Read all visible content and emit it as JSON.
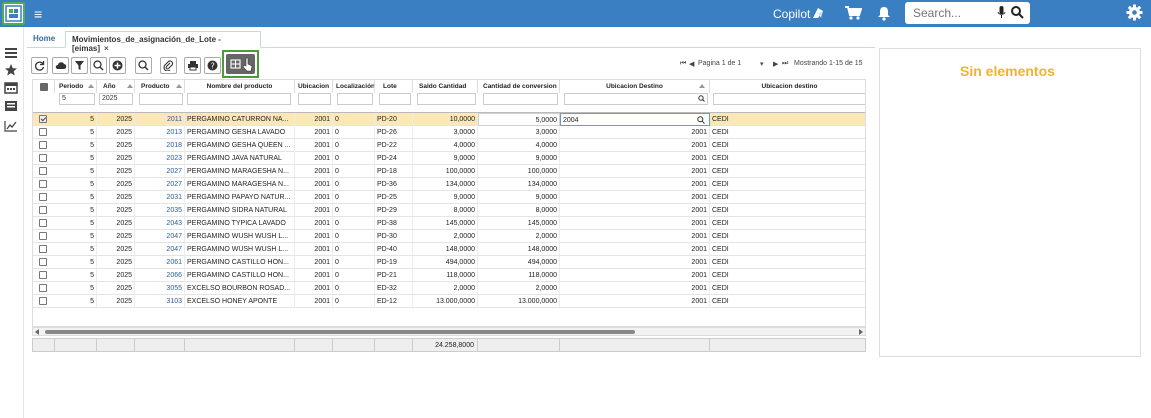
{
  "header": {
    "copilot_label": "Copilot",
    "search_placeholder": "Search..."
  },
  "tabs": [
    {
      "label": "Home"
    },
    {
      "label": "Movimientos_de_asignación_de_Lote -[eimas]",
      "close": "×"
    }
  ],
  "pager": {
    "first": "⏮",
    "prev": "◀",
    "page_text": "Pagina 1 de 1",
    "dropdown": "▾",
    "next": "▶",
    "last": "⏭",
    "showing_text": "Mostrando 1-15 de 15"
  },
  "grid": {
    "columns": [
      "Periodo",
      "Año",
      "Producto",
      "Nombre del producto",
      "Ubicacion",
      "Localización",
      "Lote",
      "Saldo Cantidad",
      "Cantidad de conversion",
      "Ubicacion Destino",
      "Ubicacion destino"
    ],
    "filters": {
      "periodo": "5",
      "anio": "2025"
    },
    "rows": [
      {
        "periodo": "5",
        "anio": "2025",
        "producto": "2011",
        "nombre": "PERGAMINO CATURRON NA...",
        "ubicacion": "2001",
        "loc": "0",
        "lote": "PD-20",
        "saldo": "10,0000",
        "conv": "5,0000",
        "destino": "2004",
        "destino2": "CEDI"
      },
      {
        "periodo": "5",
        "anio": "2025",
        "producto": "2013",
        "nombre": "PERGAMINO GESHA LAVADO",
        "ubicacion": "2001",
        "loc": "0",
        "lote": "PD-26",
        "saldo": "3,0000",
        "conv": "3,0000",
        "destino": "2001",
        "destino2": "CEDI"
      },
      {
        "periodo": "5",
        "anio": "2025",
        "producto": "2018",
        "nombre": "PERGAMINO GESHA QUEEN ...",
        "ubicacion": "2001",
        "loc": "0",
        "lote": "PD-22",
        "saldo": "4,0000",
        "conv": "4,0000",
        "destino": "2001",
        "destino2": "CEDI"
      },
      {
        "periodo": "5",
        "anio": "2025",
        "producto": "2023",
        "nombre": "PERGAMINO JAVA NATURAL",
        "ubicacion": "2001",
        "loc": "0",
        "lote": "PD-24",
        "saldo": "9,0000",
        "conv": "9,0000",
        "destino": "2001",
        "destino2": "CEDI"
      },
      {
        "periodo": "5",
        "anio": "2025",
        "producto": "2027",
        "nombre": "PERGAMINO MARAGESHA N...",
        "ubicacion": "2001",
        "loc": "0",
        "lote": "PD-18",
        "saldo": "100,0000",
        "conv": "100,0000",
        "destino": "2001",
        "destino2": "CEDI"
      },
      {
        "periodo": "5",
        "anio": "2025",
        "producto": "2027",
        "nombre": "PERGAMINO MARAGESHA N...",
        "ubicacion": "2001",
        "loc": "0",
        "lote": "PD-36",
        "saldo": "134,0000",
        "conv": "134,0000",
        "destino": "2001",
        "destino2": "CEDI"
      },
      {
        "periodo": "5",
        "anio": "2025",
        "producto": "2031",
        "nombre": "PERGAMINO PAPAYO NATUR...",
        "ubicacion": "2001",
        "loc": "0",
        "lote": "PD-25",
        "saldo": "9,0000",
        "conv": "9,0000",
        "destino": "2001",
        "destino2": "CEDI"
      },
      {
        "periodo": "5",
        "anio": "2025",
        "producto": "2035",
        "nombre": "PERGAMINO SIDRA NATURAL",
        "ubicacion": "2001",
        "loc": "0",
        "lote": "PD-29",
        "saldo": "8,0000",
        "conv": "8,0000",
        "destino": "2001",
        "destino2": "CEDI"
      },
      {
        "periodo": "5",
        "anio": "2025",
        "producto": "2043",
        "nombre": "PERGAMINO TYPICA LAVADO",
        "ubicacion": "2001",
        "loc": "0",
        "lote": "PD-38",
        "saldo": "145,0000",
        "conv": "145,0000",
        "destino": "2001",
        "destino2": "CEDI"
      },
      {
        "periodo": "5",
        "anio": "2025",
        "producto": "2047",
        "nombre": "PERGAMINO WUSH WUSH L...",
        "ubicacion": "2001",
        "loc": "0",
        "lote": "PD-30",
        "saldo": "2,0000",
        "conv": "2,0000",
        "destino": "2001",
        "destino2": "CEDI"
      },
      {
        "periodo": "5",
        "anio": "2025",
        "producto": "2047",
        "nombre": "PERGAMINO WUSH WUSH L...",
        "ubicacion": "2001",
        "loc": "0",
        "lote": "PD-40",
        "saldo": "148,0000",
        "conv": "148,0000",
        "destino": "2001",
        "destino2": "CEDI"
      },
      {
        "periodo": "5",
        "anio": "2025",
        "producto": "2061",
        "nombre": "PERGAMINO CASTILLO HON...",
        "ubicacion": "2001",
        "loc": "0",
        "lote": "PD-19",
        "saldo": "494,0000",
        "conv": "494,0000",
        "destino": "2001",
        "destino2": "CEDI"
      },
      {
        "periodo": "5",
        "anio": "2025",
        "producto": "2066",
        "nombre": "PERGAMINO CASTILLO HON...",
        "ubicacion": "2001",
        "loc": "0",
        "lote": "PD-21",
        "saldo": "118,0000",
        "conv": "118,0000",
        "destino": "2001",
        "destino2": "CEDI"
      },
      {
        "periodo": "5",
        "anio": "2025",
        "producto": "3055",
        "nombre": "EXCELSO BOURBON ROSAD...",
        "ubicacion": "2001",
        "loc": "0",
        "lote": "ED-32",
        "saldo": "2,0000",
        "conv": "2,0000",
        "destino": "2001",
        "destino2": "CEDI"
      },
      {
        "periodo": "5",
        "anio": "2025",
        "producto": "3103",
        "nombre": "EXCELSO HONEY APONTE",
        "ubicacion": "2001",
        "loc": "0",
        "lote": "ED-12",
        "saldo": "13.000,0000",
        "conv": "13.000,0000",
        "destino": "2001",
        "destino2": "CEDI"
      }
    ],
    "total_saldo": "24.258,8000"
  },
  "right_pane": {
    "title": "Sin elementos"
  },
  "colors": {
    "header": "#3a7fc1",
    "selected_row": "#fce8b6",
    "accent": "#f0b428",
    "highlight_frame": "#4d9a3a"
  }
}
